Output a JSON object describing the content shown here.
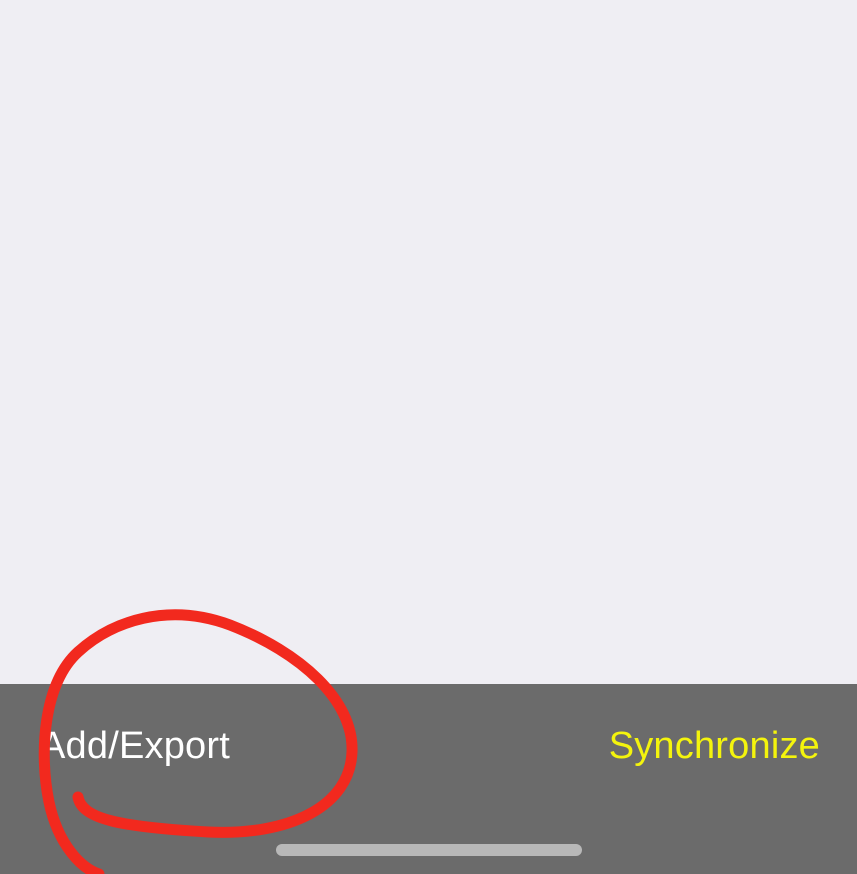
{
  "toolbar": {
    "add_export_label": "Add/Export",
    "synchronize_label": "Synchronize"
  },
  "colors": {
    "background": "#efeef3",
    "toolbar": "#6b6b6b",
    "primary_label": "#ffffff",
    "accent_label": "#f4f40d",
    "annotation": "#f2291e"
  },
  "annotation": {
    "shape": "hand-drawn red circle"
  }
}
